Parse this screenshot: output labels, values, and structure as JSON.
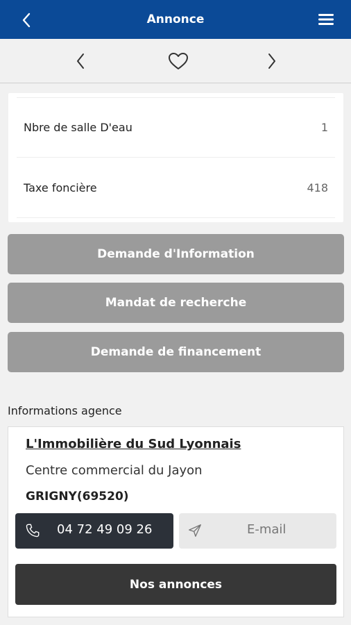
{
  "header": {
    "title": "Annonce",
    "bg_color": "#0b4a97",
    "back_icon": "chevron-left-icon",
    "menu_icon": "hamburger-menu-icon"
  },
  "nav": {
    "prev_icon": "chevron-left-icon",
    "favorite_icon": "heart-outline-icon",
    "next_icon": "chevron-right-icon"
  },
  "details": [
    {
      "label": "Nbre de salle D'eau",
      "value": "1"
    },
    {
      "label": "Taxe foncière",
      "value": "418"
    }
  ],
  "actions": {
    "info_request": "Demande d'Information",
    "search_mandate": "Mandat de recherche",
    "financing_request": "Demande de financement",
    "color": "#9b9b9b"
  },
  "agency": {
    "section_title": "Informations agence",
    "name": "L'Immobilière du Sud Lyonnais",
    "address": "Centre commercial du Jayon",
    "city": "GRIGNY(69520)",
    "phone": "04 72 49 09 26",
    "phone_icon": "phone-icon",
    "email_label": "E-mail",
    "email_icon": "send-icon",
    "listings_label": "Nos annonces"
  }
}
